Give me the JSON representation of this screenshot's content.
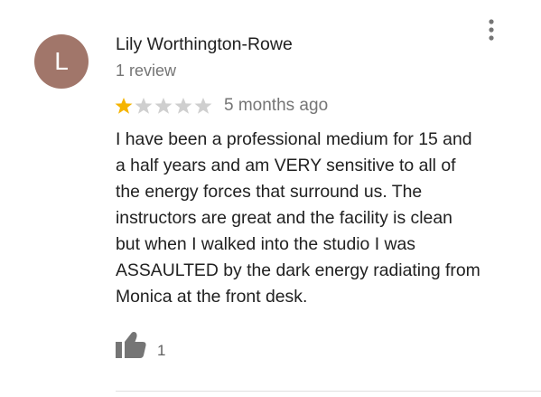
{
  "reviewer": {
    "avatar_letter": "L",
    "avatar_color": "#a1766a",
    "name": "Lily Worthington-Rowe",
    "review_count": "1 review"
  },
  "review": {
    "rating": 1,
    "max_rating": 5,
    "star_filled_color": "#f5b400",
    "star_empty_color": "#cfcfcf",
    "time": "5 months ago",
    "lines": [
      "I have been a professional medium for 15 and",
      "a half years and am VERY sensitive to all of",
      "the energy forces that surround us. The",
      "instructors are great and the facility is clean",
      "but when I walked into the studio I was",
      "ASSAULTED by the dark energy radiating from",
      "Monica at the front desk."
    ]
  },
  "actions": {
    "more_icon": "more-vert-icon",
    "like_icon": "thumb-up-icon",
    "like_count": "1"
  }
}
